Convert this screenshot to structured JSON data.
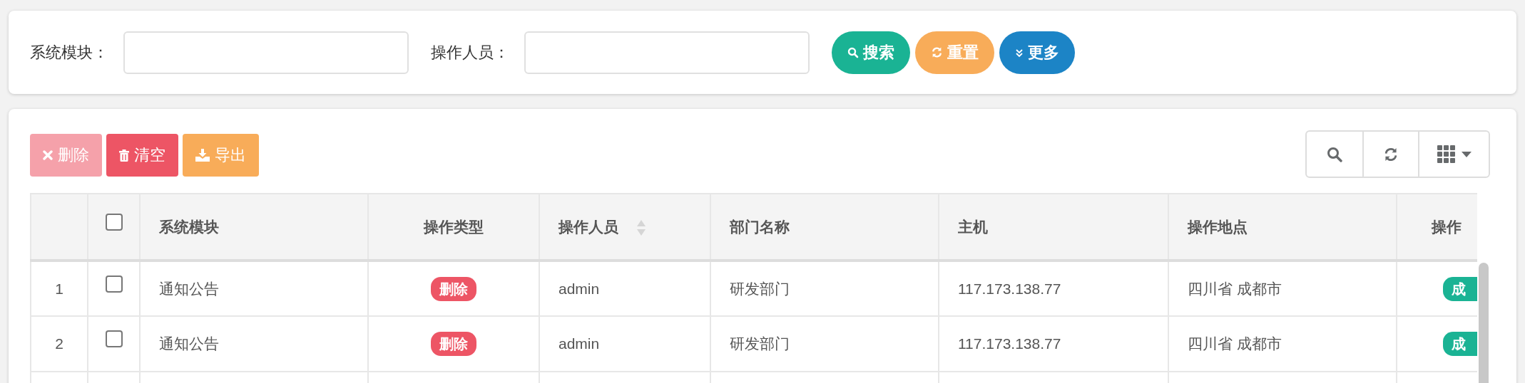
{
  "search_form": {
    "fields": [
      {
        "label": "系统模块："
      },
      {
        "label": "操作人员："
      }
    ],
    "buttons": [
      {
        "kind": "search",
        "label": "搜索"
      },
      {
        "kind": "reset",
        "label": "重置"
      },
      {
        "kind": "more",
        "label": "更多"
      }
    ]
  },
  "toolbar": {
    "buttons": [
      {
        "kind": "delete",
        "label": "删除",
        "disabled": true
      },
      {
        "kind": "clear",
        "label": "清空",
        "disabled": false
      },
      {
        "kind": "export",
        "label": "导出",
        "disabled": false
      }
    ],
    "tools": [
      {
        "kind": "search"
      },
      {
        "kind": "refresh"
      },
      {
        "kind": "columns"
      }
    ]
  },
  "table": {
    "all_checked": false,
    "columns": [
      {
        "label": "系统模块"
      },
      {
        "label": "操作类型"
      },
      {
        "label": "操作人员",
        "sortable": true
      },
      {
        "label": "部门名称"
      },
      {
        "label": "主机"
      },
      {
        "label": "操作地点"
      },
      {
        "label": "操作"
      }
    ],
    "rows": [
      {
        "index": "1",
        "checked": false,
        "module": "通知公告",
        "type": {
          "label": "删除",
          "color": "#ed5565"
        },
        "operator": "admin",
        "department": "研发部门",
        "host": "117.173.138.77",
        "location": "四川省 成都市",
        "status": {
          "label": "成",
          "color": "#1ab394"
        }
      },
      {
        "index": "2",
        "checked": false,
        "module": "通知公告",
        "type": {
          "label": "删除",
          "color": "#ed5565"
        },
        "operator": "admin",
        "department": "研发部门",
        "host": "117.173.138.77",
        "location": "四川省 成都市",
        "status": {
          "label": "成",
          "color": "#1ab394"
        }
      }
    ]
  }
}
